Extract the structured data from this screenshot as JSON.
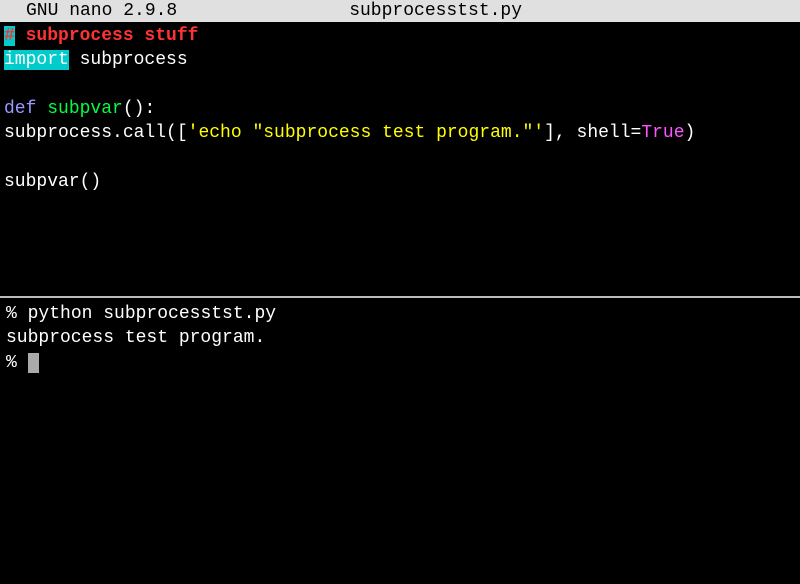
{
  "header": {
    "app_version": "GNU nano  2.9.8",
    "filename": "subprocesstst.py"
  },
  "editor": {
    "lines": {
      "l1_comment_marker": "#",
      "l1_comment_rest": " subprocess stuff",
      "l2_import": "import",
      "l2_module": " subprocess",
      "l3_blank": "",
      "l4_def": "def",
      "l4_space": " ",
      "l4_func": "subpvar",
      "l4_parens": "():",
      "l5_indent": " subprocess.call([",
      "l5_string": "'echo \"subprocess test program.\"'",
      "l5_mid": "], shell=",
      "l5_true": "True",
      "l5_end": ")",
      "l6_blank": "",
      "l7_call": "subpvar()"
    }
  },
  "terminal": {
    "l1_prompt": "% ",
    "l1_cmd": "python subprocesstst.py",
    "l2_output": "subprocess test program.",
    "l3_prompt": "% "
  }
}
